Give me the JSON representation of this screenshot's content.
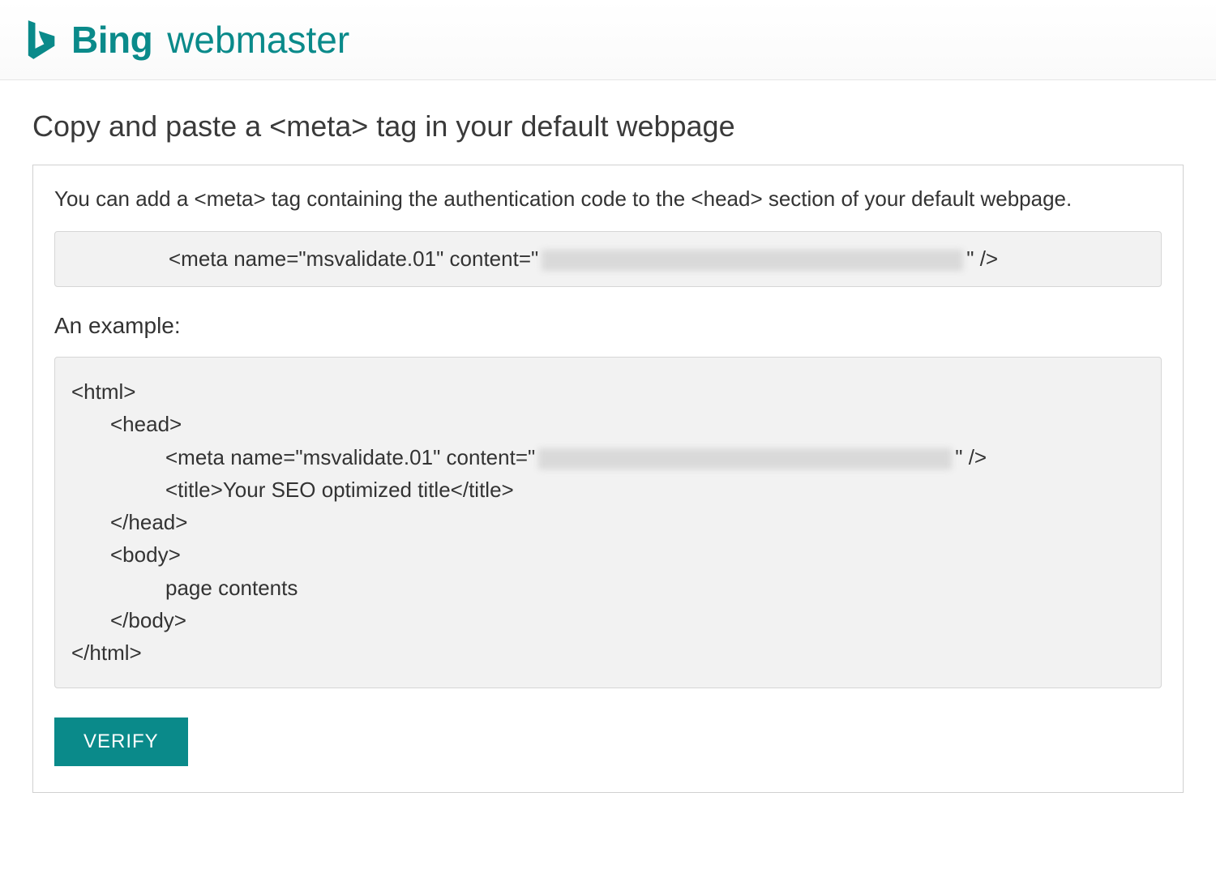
{
  "header": {
    "brand": "Bing",
    "sub": "webmaster"
  },
  "page": {
    "title": "Copy and paste a <meta> tag in your default webpage",
    "instruction": "You can add a <meta> tag containing the authentication code to the <head> section of your default webpage.",
    "meta_prefix": "<meta name=\"msvalidate.01\" content=\"",
    "meta_suffix": "\" />",
    "example_label": "An example:",
    "example": {
      "open_html": "<html>",
      "open_head": "<head>",
      "meta_prefix": "<meta name=\"msvalidate.01\" content=\"",
      "meta_suffix": "\" />",
      "title_line": "<title>Your SEO optimized title</title>",
      "close_head": "</head>",
      "open_body": "<body>",
      "body_content": "page contents",
      "close_body": "</body>",
      "close_html": "</html>"
    },
    "verify_label": "VERIFY"
  }
}
